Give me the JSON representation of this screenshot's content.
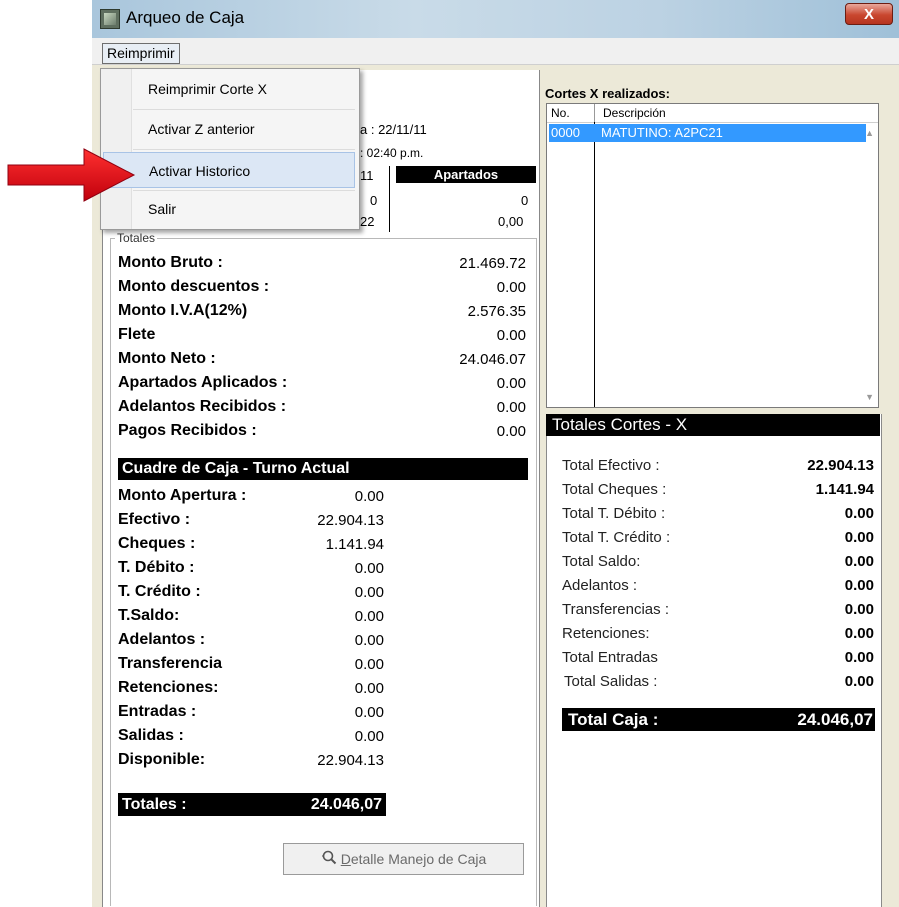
{
  "window": {
    "title": "Arqueo de Caja",
    "close_glyph": "X"
  },
  "menubar": {
    "reimprimir": "Reimprimir"
  },
  "dropdown": {
    "items": [
      "Reimprimir Corte X",
      "Activar Z anterior",
      "Activar Historico",
      "Salir"
    ],
    "highlighted": "Activar Historico"
  },
  "background_fragments": {
    "fecha": "a : 22/11/11",
    "hora": ":  02:40 p.m.",
    "col_frag": "11",
    "row_frag_1": "0",
    "row_frag_2": "22",
    "apartados_header": "Apartados",
    "apartados_count": "0",
    "apartados_amount": "0,00"
  },
  "totales": {
    "legend": "Totales",
    "rows": [
      {
        "label": "Monto Bruto :",
        "value": "21.469.72"
      },
      {
        "label": "Monto descuentos :",
        "value": "0.00"
      },
      {
        "label": "Monto I.V.A(12%)",
        "value": "2.576.35"
      },
      {
        "label": "Flete",
        "value": "0.00"
      },
      {
        "label": "Monto Neto :",
        "value": "24.046.07"
      },
      {
        "label": "Apartados  Aplicados :",
        "value": "0.00"
      },
      {
        "label": "Adelantos Recibidos :",
        "value": "0.00"
      },
      {
        "label": "Pagos Recibidos :",
        "value": "0.00"
      }
    ]
  },
  "cuadre": {
    "header": "Cuadre de Caja - Turno Actual",
    "rows": [
      {
        "label": "Monto Apertura :",
        "value": "0.00"
      },
      {
        "label": "Efectivo :",
        "value": "22.904.13"
      },
      {
        "label": "Cheques :",
        "value": "1.141.94"
      },
      {
        "label": "T. Débito :",
        "value": "0.00"
      },
      {
        "label": "T. Crédito :",
        "value": "0.00"
      },
      {
        "label": "T.Saldo:",
        "value": "0.00"
      },
      {
        "label": "Adelantos :",
        "value": "0.00"
      },
      {
        "label": "Transferencia",
        "value": "0.00"
      },
      {
        "label": "Retenciones:",
        "value": "0.00"
      },
      {
        "label": "Entradas :",
        "value": "0.00"
      },
      {
        "label": "Salidas :",
        "value": "0.00"
      },
      {
        "label": "Disponible:",
        "value": "22.904.13"
      }
    ],
    "totales_label": "Totales :",
    "totales_value": "24.046,07"
  },
  "detail_button": {
    "mnemonic": "D",
    "rest": "etalle Manejo de Caja"
  },
  "cortes": {
    "title": "Cortes X realizados:",
    "columns": [
      "No.",
      "Descripción"
    ],
    "rows": [
      {
        "no": "0000",
        "descripcion": "MATUTINO: A2PC21"
      }
    ]
  },
  "totales_cortes": {
    "header": "Totales Cortes - X",
    "rows": [
      {
        "label": "Total Efectivo :",
        "value": "22.904.13"
      },
      {
        "label": "Total Cheques :",
        "value": "1.141.94"
      },
      {
        "label": "Total T. Débito :",
        "value": "0.00"
      },
      {
        "label": "Total T. Crédito :",
        "value": "0.00"
      },
      {
        "label": "Total Saldo:",
        "value": "0.00"
      },
      {
        "label": "Adelantos :",
        "value": "0.00"
      },
      {
        "label": "Transferencias :",
        "value": "0.00"
      },
      {
        "label": "Retenciones:",
        "value": "0.00"
      },
      {
        "label": "Total Entradas",
        "value": "0.00"
      },
      {
        "label": "Total Salidas :",
        "value": "0.00"
      }
    ],
    "total_caja_label": "Total Caja :",
    "total_caja_value": "24.046,07"
  },
  "colors": {
    "highlight": "#3399ff",
    "arrow": "#e8001c",
    "menu_hover": "#dce7f5"
  }
}
